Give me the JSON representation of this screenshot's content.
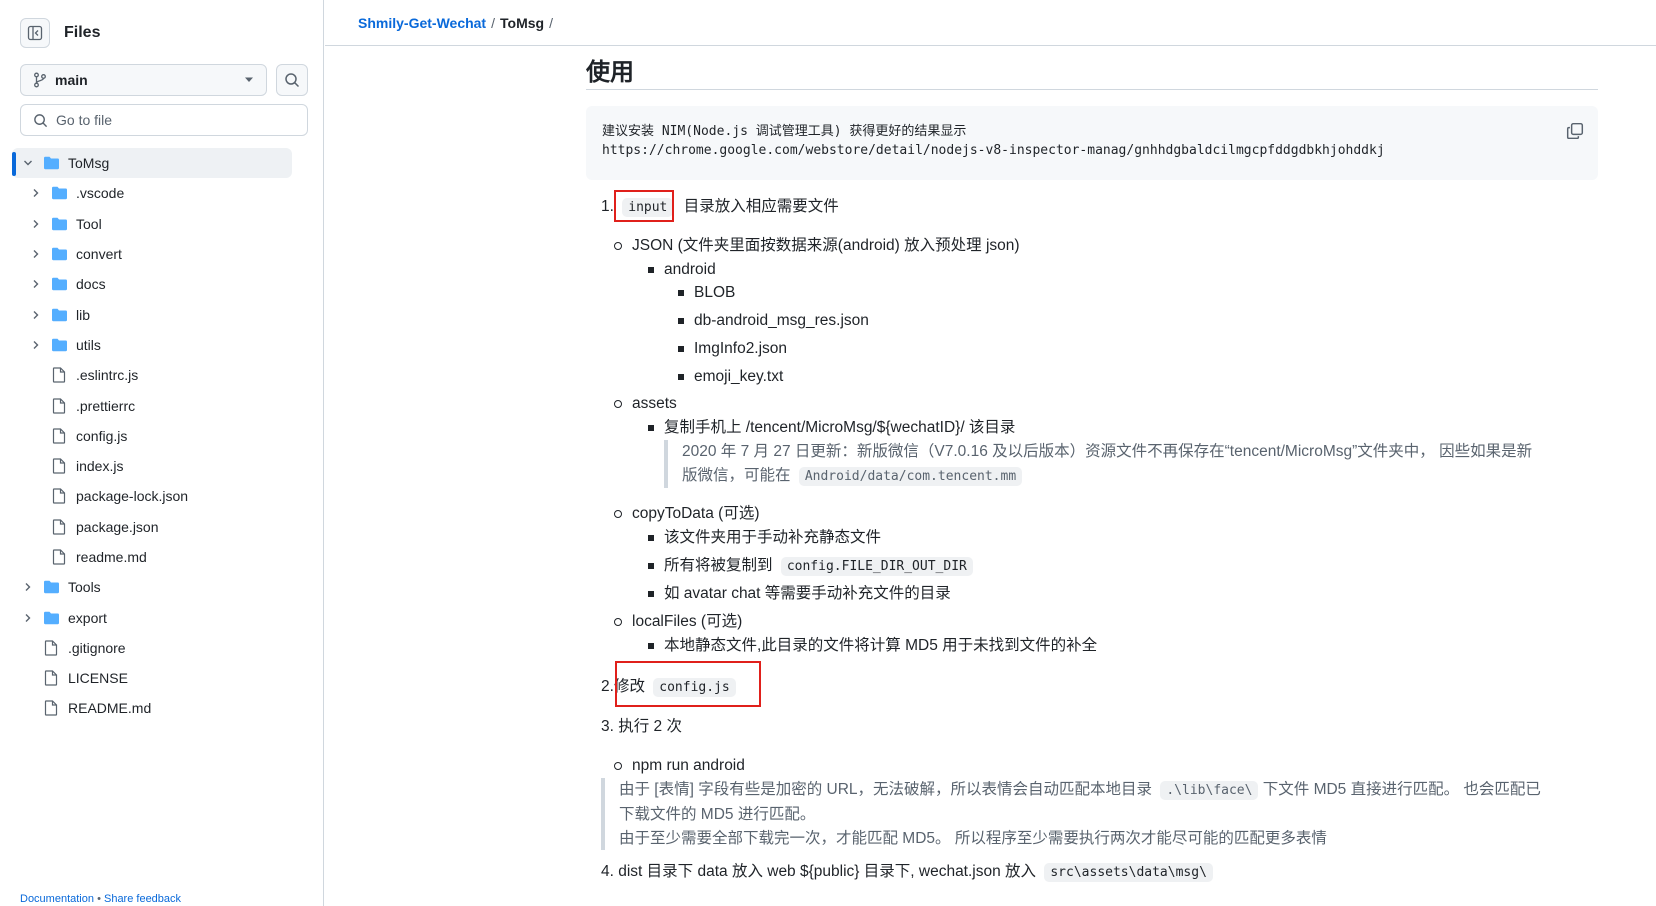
{
  "sidebar": {
    "title": "Files",
    "branch": "main",
    "goto_placeholder": "Go to file",
    "tree": [
      {
        "name": "ToMsg",
        "type": "folder",
        "depth": 0,
        "expanded": true,
        "selected": true
      },
      {
        "name": ".vscode",
        "type": "folder",
        "depth": 1
      },
      {
        "name": "Tool",
        "type": "folder",
        "depth": 1
      },
      {
        "name": "convert",
        "type": "folder",
        "depth": 1
      },
      {
        "name": "docs",
        "type": "folder",
        "depth": 1
      },
      {
        "name": "lib",
        "type": "folder",
        "depth": 1
      },
      {
        "name": "utils",
        "type": "folder",
        "depth": 1
      },
      {
        "name": ".eslintrc.js",
        "type": "file",
        "depth": 1
      },
      {
        "name": ".prettierrc",
        "type": "file",
        "depth": 1
      },
      {
        "name": "config.js",
        "type": "file",
        "depth": 1
      },
      {
        "name": "index.js",
        "type": "file",
        "depth": 1
      },
      {
        "name": "package-lock.json",
        "type": "file",
        "depth": 1
      },
      {
        "name": "package.json",
        "type": "file",
        "depth": 1
      },
      {
        "name": "readme.md",
        "type": "file",
        "depth": 1
      },
      {
        "name": "Tools",
        "type": "folder",
        "depth": 0
      },
      {
        "name": "export",
        "type": "folder",
        "depth": 0
      },
      {
        "name": ".gitignore",
        "type": "file",
        "depth": 0
      },
      {
        "name": "LICENSE",
        "type": "file",
        "depth": 0
      },
      {
        "name": "README.md",
        "type": "file",
        "depth": 0
      }
    ],
    "footer_docs": "Documentation",
    "footer_sep": "•",
    "footer_feedback": "Share feedback"
  },
  "breadcrumb": {
    "repo": "Shmily-Get-Wechat",
    "sep": "/",
    "folder": "ToMsg",
    "trail": "/"
  },
  "content": {
    "heading": "使用",
    "code_line1": "建议安装 NIM(Node.js 调试管理工具) 获得更好的结果显示",
    "code_line2": "https://chrome.google.com/webstore/detail/nodejs-v8-inspector-manag/gnhhdgbaldcilmgcpfddgdbkhjohddkj",
    "step1_num": "1.",
    "step1_code": "input",
    "step1_text": "目录放入相应需要文件",
    "json_item": "JSON (文件夹里面按数据来源(android) 放入预处理 json)",
    "android": "android",
    "blob": "BLOB",
    "db_json": "db-android_msg_res.json",
    "imginfo": "ImgInfo2.json",
    "emoji": "emoji_key.txt",
    "assets": "assets",
    "copy_phone": "复制手机上 /tencent/MicroMsg/${wechatID}/ 该目录",
    "quote1_line1": "2020 年 7 月 27 日更新：新版微信（V7.0.16 及以后版本）资源文件不再保存在“tencent/MicroMsg”文件夹中， 因些如果是新",
    "quote1_line2_pre": "版微信，可能在",
    "quote1_code": "Android/data/com.tencent.mm",
    "copytodata": "copyToData (可选)",
    "ctd1": "该文件夹用于手动补充静态文件",
    "ctd2_pre": "所有将被复制到",
    "ctd2_code": "config.FILE_DIR_OUT_DIR",
    "ctd3": "如 avatar chat 等需要手动补充文件的目录",
    "localfiles": "localFiles (可选)",
    "lf1": "本地静态文件,此目录的文件将计算 MD5 用于未找到文件的补全",
    "step2_num": "2.",
    "step2_text": "修改",
    "step2_code": "config.js",
    "step3": "3. 执行 2 次",
    "npm": "npm run android",
    "quote2_line1_pre": "由于 [表情] 字段有些是加密的 URL，无法破解，所以表情会自动匹配本地目录",
    "quote2_code": ".\\lib\\face\\",
    "quote2_line1_post": "下文件 MD5 直接进行匹配。 也会匹配已",
    "quote2_line2": "下载文件的 MD5 进行匹配。",
    "quote2_line3": "由于至少需要全部下载完一次，才能匹配 MD5。 所以程序至少需要执行两次才能尽可能的匹配更多表情",
    "step4_pre": "4. dist 目录下 data 放入 web ${public} 目录下, wechat.json 放入",
    "step4_code": "src\\assets\\data\\msg\\"
  },
  "colors": {
    "link": "#0969da",
    "folder": "#54aeff",
    "highlight_box": "#e0201b",
    "border": "#d0d7de"
  }
}
